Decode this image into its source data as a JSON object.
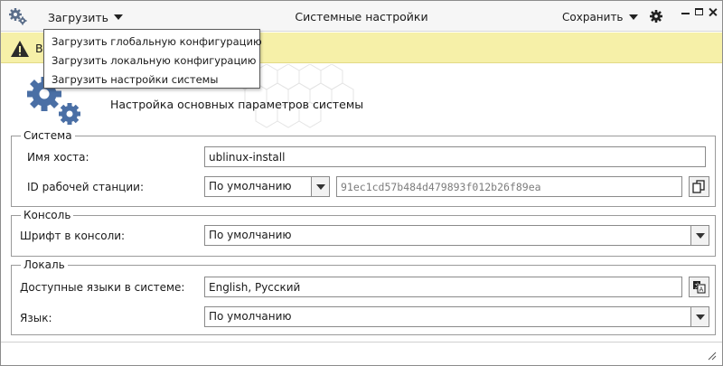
{
  "window": {
    "title": "Системные настройки"
  },
  "header": {
    "load_label": "Загрузить",
    "save_label": "Сохранить",
    "app_icon": "gears-icon",
    "settings_icon": "gear-icon"
  },
  "infobar": {
    "text": "В",
    "icon": "warning-icon",
    "color": "#f6f0a8"
  },
  "load_menu": {
    "items": [
      "Загрузить глобальную конфигурацию",
      "Загрузить локальную конфигурацию",
      "Загрузить настройки системы"
    ]
  },
  "banner": {
    "title": "Настройка основных параметров системы",
    "accent": "#4a6fa5"
  },
  "system": {
    "title": "Система",
    "hostname_label": "Имя хоста:",
    "hostname_value": "ublinux-install",
    "machine_id_label": "ID рабочей станции:",
    "machine_id_mode": "По умолчанию",
    "machine_id_value": "91ec1cd57b484d479893f012b26f89ea",
    "copy_icon": "copy-icon"
  },
  "console": {
    "title": "Консоль",
    "font_label": "Шрифт в консоли:",
    "font_value": "По умолчанию"
  },
  "locale": {
    "title": "Локаль",
    "languages_label": "Доступные языки в системе:",
    "languages_value": "English, Русский",
    "language_label": "Язык:",
    "language_value": "По умолчанию",
    "translate_icon": "translate-icon"
  }
}
